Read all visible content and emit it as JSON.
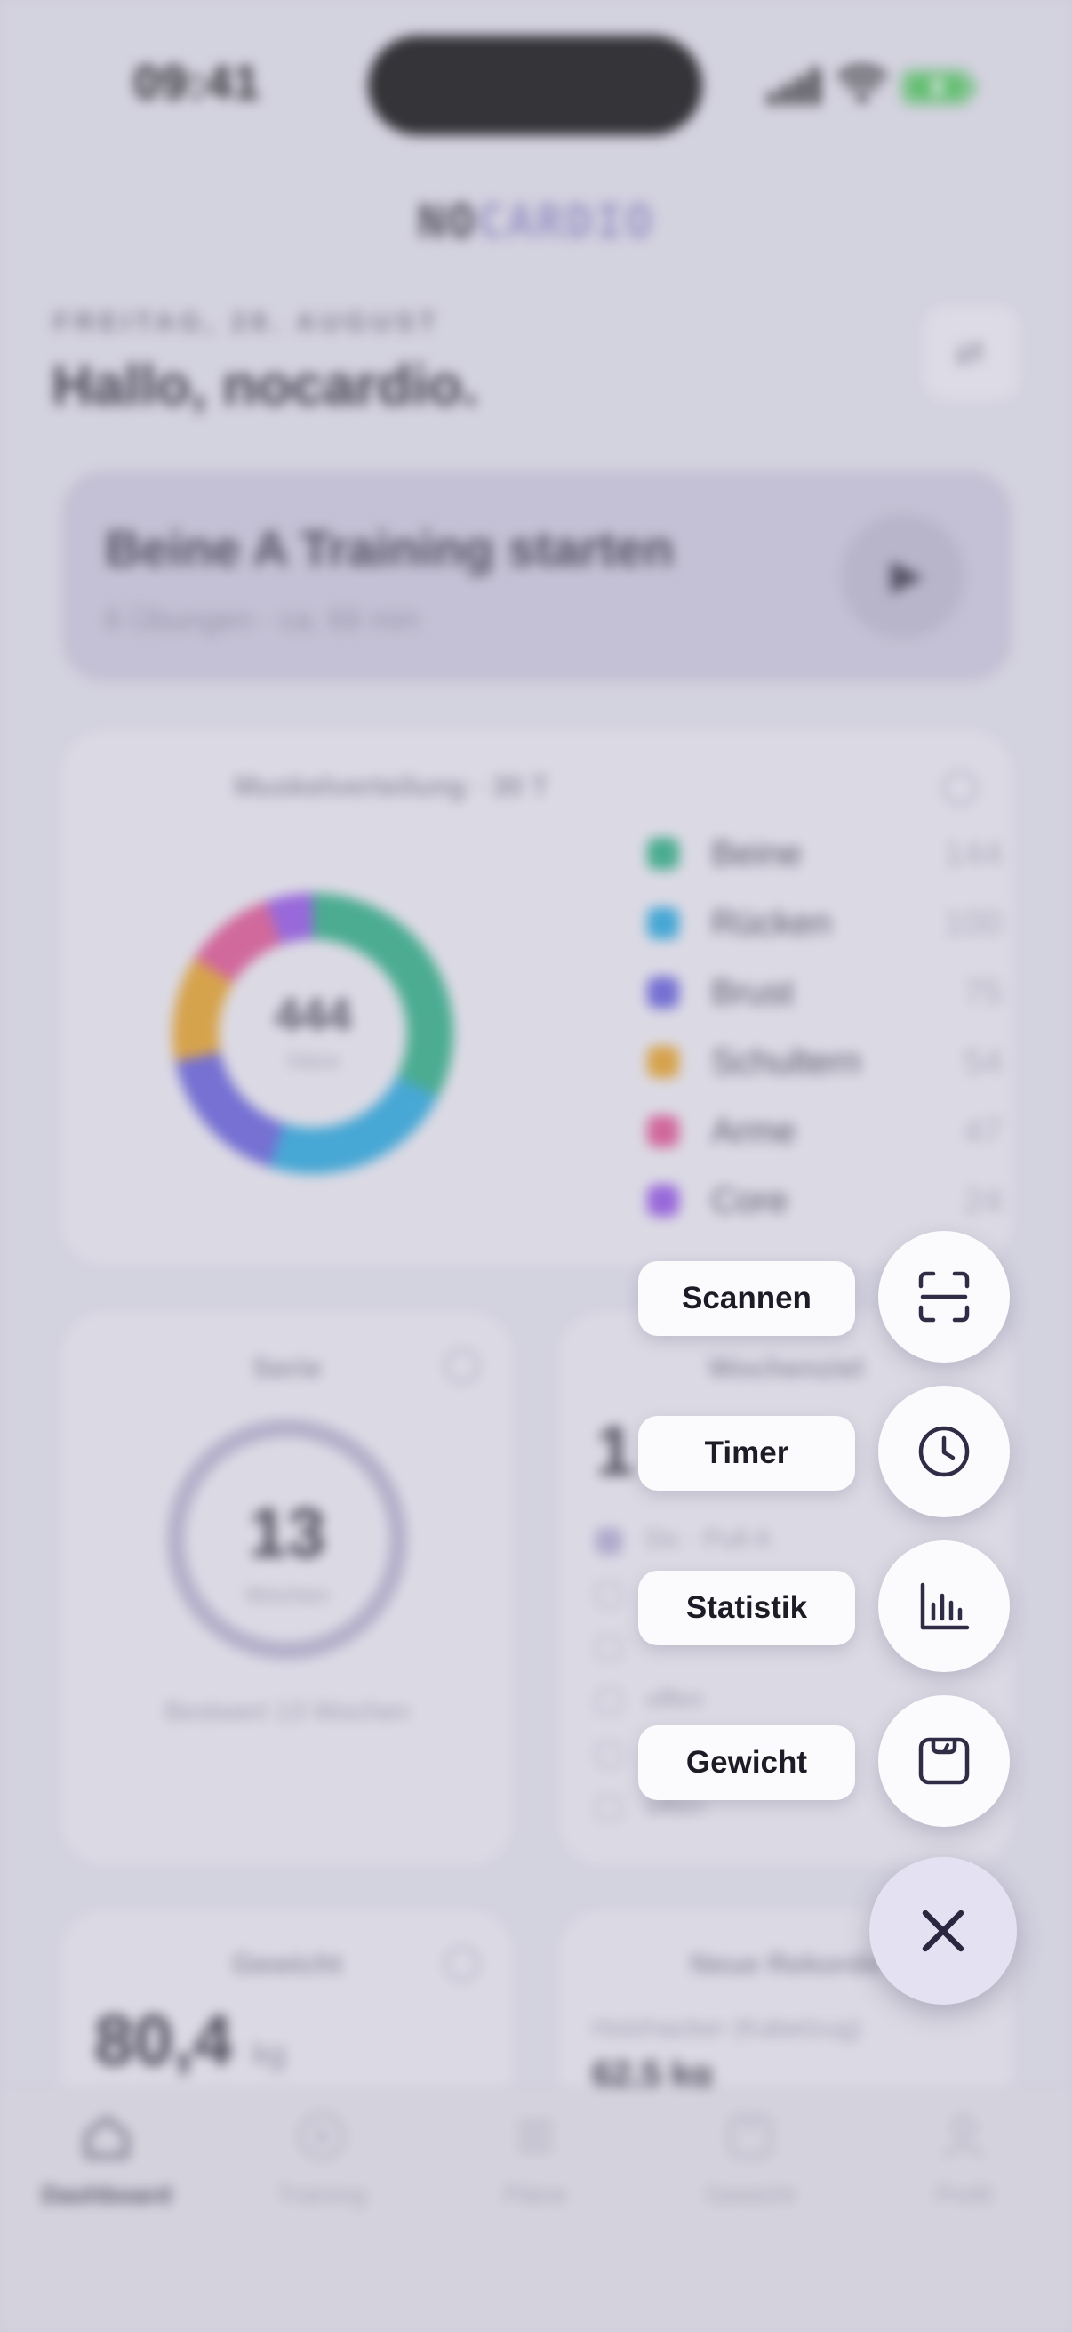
{
  "status_bar": {
    "time": "09:41"
  },
  "brand": {
    "part1": "NO",
    "part2": "CARDIO"
  },
  "header": {
    "date": "FREITAG, 28. AUGUST",
    "greeting": "Hallo, nocardio."
  },
  "start_card": {
    "title": "Beine A Training starten",
    "subtitle": "6 Übungen · ca. 66 min"
  },
  "muscle_card": {
    "title": "Muskelverteilung · 30 T",
    "total": "444",
    "unit": "Sätze",
    "items": [
      {
        "name": "Beine",
        "value": 144,
        "color": "#1fa77a"
      },
      {
        "name": "Rücken",
        "value": 100,
        "color": "#1aa0d8"
      },
      {
        "name": "Brust",
        "value": 75,
        "color": "#5a55d6"
      },
      {
        "name": "Schultern",
        "value": 54,
        "color": "#e09a1c"
      },
      {
        "name": "Arme",
        "value": 47,
        "color": "#d94a8a"
      },
      {
        "name": "Core",
        "value": 24,
        "color": "#8a4ae0"
      }
    ]
  },
  "streak_card": {
    "title": "Serie",
    "value": "13",
    "unit": "Wochen",
    "footer": "Bestwert 13 Wochen"
  },
  "goal_card": {
    "title": "Wochenziel",
    "value": "1",
    "items": [
      {
        "label": "Do · Pull A",
        "done": true
      },
      {
        "label": "",
        "done": false
      },
      {
        "label": "",
        "done": false
      },
      {
        "label": "offen",
        "done": false
      },
      {
        "label": "",
        "done": false
      },
      {
        "label": "offen",
        "done": false
      }
    ]
  },
  "weight_card": {
    "title": "Gewicht",
    "value": "80,4",
    "unit": "kg"
  },
  "records_card": {
    "title": "Neue Rekorde",
    "item": "Holzhacker (Kabelzug)",
    "value": "62,5 kg"
  },
  "tabs": [
    {
      "label": "Dashboard",
      "icon": "home-icon",
      "active": true
    },
    {
      "label": "Training",
      "icon": "play-circle-icon",
      "active": false
    },
    {
      "label": "Pläne",
      "icon": "list-icon",
      "active": false
    },
    {
      "label": "Gewicht",
      "icon": "scale-icon",
      "active": false
    },
    {
      "label": "Profil",
      "icon": "person-icon",
      "active": false
    }
  ],
  "quick_actions": [
    {
      "label": "Scannen",
      "icon": "scan-icon"
    },
    {
      "label": "Timer",
      "icon": "clock-icon"
    },
    {
      "label": "Statistik",
      "icon": "bar-chart-icon"
    },
    {
      "label": "Gewicht",
      "icon": "scale-icon"
    }
  ],
  "fab": {
    "icon": "close-icon"
  }
}
